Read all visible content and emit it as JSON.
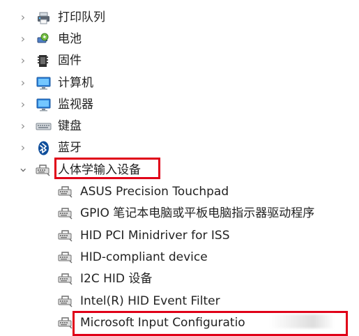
{
  "tree": {
    "top_items": [
      {
        "label": "打印队列",
        "expanded": false
      },
      {
        "label": "电池",
        "expanded": false
      },
      {
        "label": "固件",
        "expanded": false
      },
      {
        "label": "计算机",
        "expanded": false
      },
      {
        "label": "监视器",
        "expanded": false
      },
      {
        "label": "键盘",
        "expanded": false
      },
      {
        "label": "蓝牙",
        "expanded": false
      },
      {
        "label": "人体学输入设备",
        "expanded": true
      }
    ],
    "human_interface_children": [
      {
        "label": "ASUS Precision Touchpad"
      },
      {
        "label": "GPIO 笔记本电脑或平板电脑指示器驱动程序"
      },
      {
        "label": "HID PCI Minidriver for ISS"
      },
      {
        "label": "HID-compliant device"
      },
      {
        "label": "I2C HID 设备"
      },
      {
        "label": "Intel(R) HID Event Filter"
      },
      {
        "label": "Microsoft Input Configuratio"
      }
    ]
  },
  "icons": {
    "printer": "printer-icon",
    "battery": "battery-icon",
    "firmware": "firmware-icon",
    "computer": "monitor-icon",
    "monitor": "monitor-icon",
    "keyboard": "keyboard-icon",
    "bluetooth": "bluetooth-icon",
    "human_interface": "hid-device-icon"
  },
  "colors": {
    "highlight": "#e00018",
    "chevron": "#8b8b8b",
    "text": "#222222"
  }
}
